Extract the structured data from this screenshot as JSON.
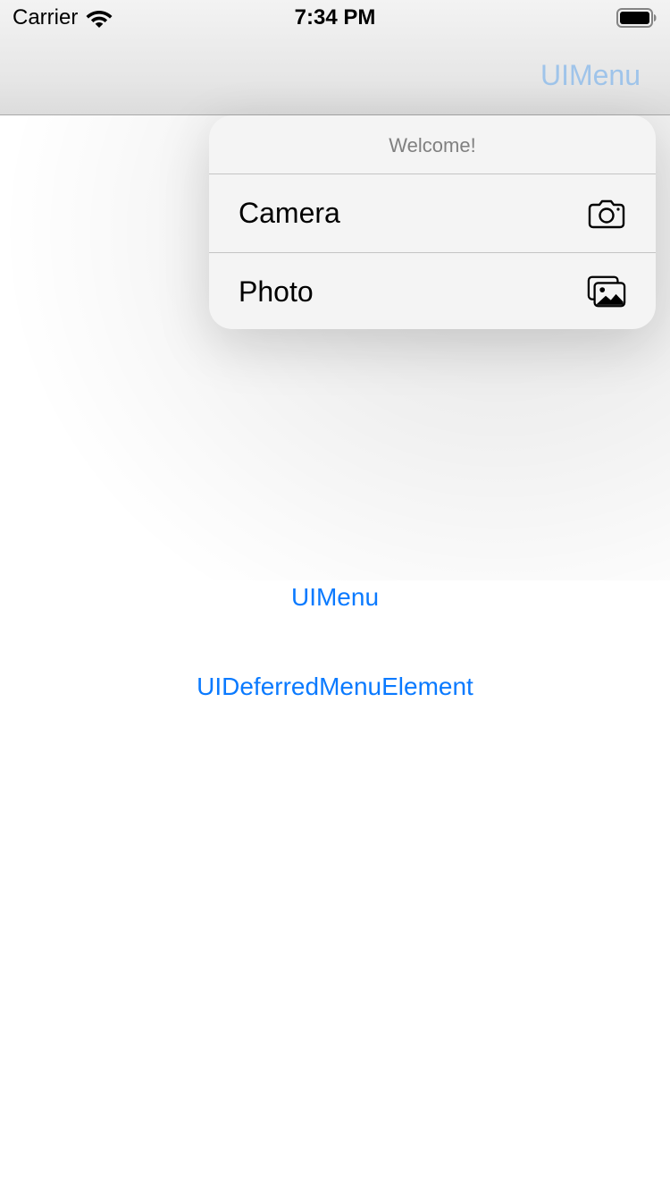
{
  "status_bar": {
    "carrier": "Carrier",
    "time": "7:34 PM",
    "wifi_icon": "wifi-icon",
    "battery_icon": "battery-icon"
  },
  "nav_bar": {
    "menu_button_label": "UIMenu",
    "button_color": "#9fc4ea"
  },
  "menu": {
    "title": "Welcome!",
    "items": [
      {
        "label": "Camera",
        "icon": "camera-icon"
      },
      {
        "label": "Photo",
        "icon": "photo-icon"
      }
    ]
  },
  "main": {
    "uimenu_label": "UIMenu",
    "deferred_label": "UIDeferredMenuElement",
    "link_color": "#0a7aff"
  }
}
